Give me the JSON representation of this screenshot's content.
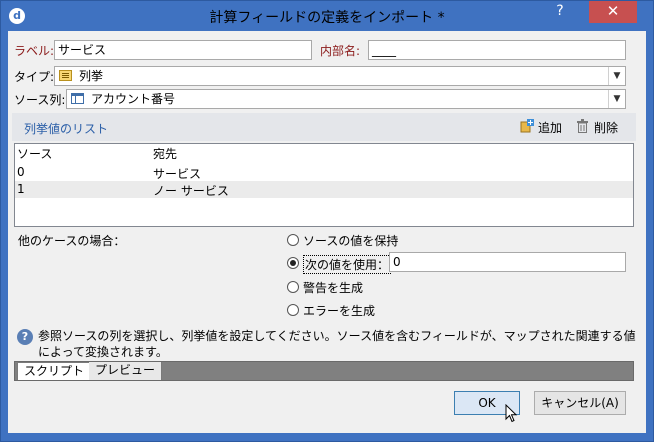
{
  "window": {
    "title": "計算フィールドの定義をインポート *",
    "help": "?",
    "close": "✕",
    "app_icon": "d"
  },
  "form": {
    "label_label": "ラベル:",
    "label_value": "サービス",
    "internal_name_label": "内部名:",
    "internal_name_value": "____",
    "type_label": "タイプ:",
    "type_value": "列挙",
    "type_icon": "list-icon",
    "source_column_label": "ソース列:",
    "source_column_value": "アカウント番号",
    "source_column_icon": "table-column-icon"
  },
  "enum_list": {
    "title": "列挙値のリスト",
    "add_label": "追加",
    "delete_label": "削除",
    "columns": [
      "ソース",
      "宛先"
    ],
    "rows": [
      {
        "source": "0",
        "dest": "サービス"
      },
      {
        "source": "1",
        "dest": "ノー サービス"
      }
    ]
  },
  "other_cases": {
    "label": "他のケースの場合：",
    "options": [
      {
        "label": "ソースの値を保持",
        "selected": false
      },
      {
        "label": "次の値を使用：",
        "selected": true
      },
      {
        "label": "警告を生成",
        "selected": false
      },
      {
        "label": "エラーを生成",
        "selected": false
      }
    ],
    "use_value": "0"
  },
  "info": {
    "text": "参照ソースの列を選択し、列挙値を設定してください。ソース値を含むフィールドが、マップされた関連する値によって変換されます。"
  },
  "tabs": [
    {
      "label": "スクリプト",
      "active": true
    },
    {
      "label": "プレビュー",
      "active": false
    }
  ],
  "buttons": {
    "ok": "OK",
    "cancel": "キャンセル(A)"
  },
  "colors": {
    "titlebar": "#3f72c1",
    "close": "#c75050",
    "section_title": "#2b5fa8",
    "label_red": "#8b1a1a"
  }
}
